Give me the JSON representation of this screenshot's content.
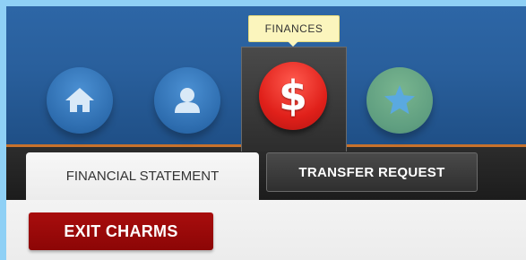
{
  "charms": {
    "items": [
      {
        "name": "home",
        "icon": "home-icon"
      },
      {
        "name": "profile",
        "icon": "person-icon"
      },
      {
        "name": "finances",
        "icon": "dollar-icon",
        "active": true
      },
      {
        "name": "favorites",
        "icon": "star-icon"
      }
    ],
    "tooltip": "FINANCES"
  },
  "tabs": {
    "active_label": "FINANCIAL STATEMENT",
    "inactive_label": "TRANSFER REQUEST"
  },
  "actions": {
    "exit_label": "EXIT CHARMS"
  },
  "colors": {
    "header_blue": "#2d66a6",
    "accent_orange": "#c8722c",
    "finance_red": "#e0201a",
    "exit_red": "#9a0a0a",
    "tooltip_yellow": "#fbf5bd"
  },
  "dollar_glyph": "$"
}
